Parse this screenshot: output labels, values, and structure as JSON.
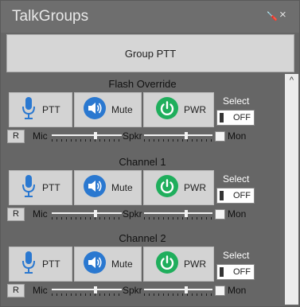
{
  "window": {
    "title": "TalkGroups",
    "pin_icon": "pin-icon",
    "close_glyph": "×"
  },
  "group_ptt": {
    "label": "Group PTT"
  },
  "scrollbar": {
    "up_glyph": "^"
  },
  "channels": [
    {
      "name": "Flash Override",
      "ptt_label": "PTT",
      "mute_label": "Mute",
      "pwr_label": "PWR",
      "select_label": "Select",
      "toggle_state": "OFF",
      "r_label": "R",
      "mic_label": "Mic",
      "spkr_label": "Spkr",
      "mon_label": "Mon",
      "mic_level": 0.62,
      "spkr_level": 0.61,
      "mon_checked": false
    },
    {
      "name": "Channel 1",
      "ptt_label": "PTT",
      "mute_label": "Mute",
      "pwr_label": "PWR",
      "select_label": "Select",
      "toggle_state": "OFF",
      "r_label": "R",
      "mic_label": "Mic",
      "spkr_label": "Spkr",
      "mon_label": "Mon",
      "mic_level": 0.62,
      "spkr_level": 0.61,
      "mon_checked": false
    },
    {
      "name": "Channel 2",
      "ptt_label": "PTT",
      "mute_label": "Mute",
      "pwr_label": "PWR",
      "select_label": "Select",
      "toggle_state": "OFF",
      "r_label": "R",
      "mic_label": "Mic",
      "spkr_label": "Spkr",
      "mon_label": "Mon",
      "mic_level": 0.62,
      "spkr_level": 0.61,
      "mon_checked": false
    }
  ],
  "colors": {
    "background": "#666666",
    "button": "#d3d3d3",
    "mic_blue": "#2a78d0",
    "speaker_blue": "#2a78d0",
    "power_green": "#1fae5c"
  }
}
